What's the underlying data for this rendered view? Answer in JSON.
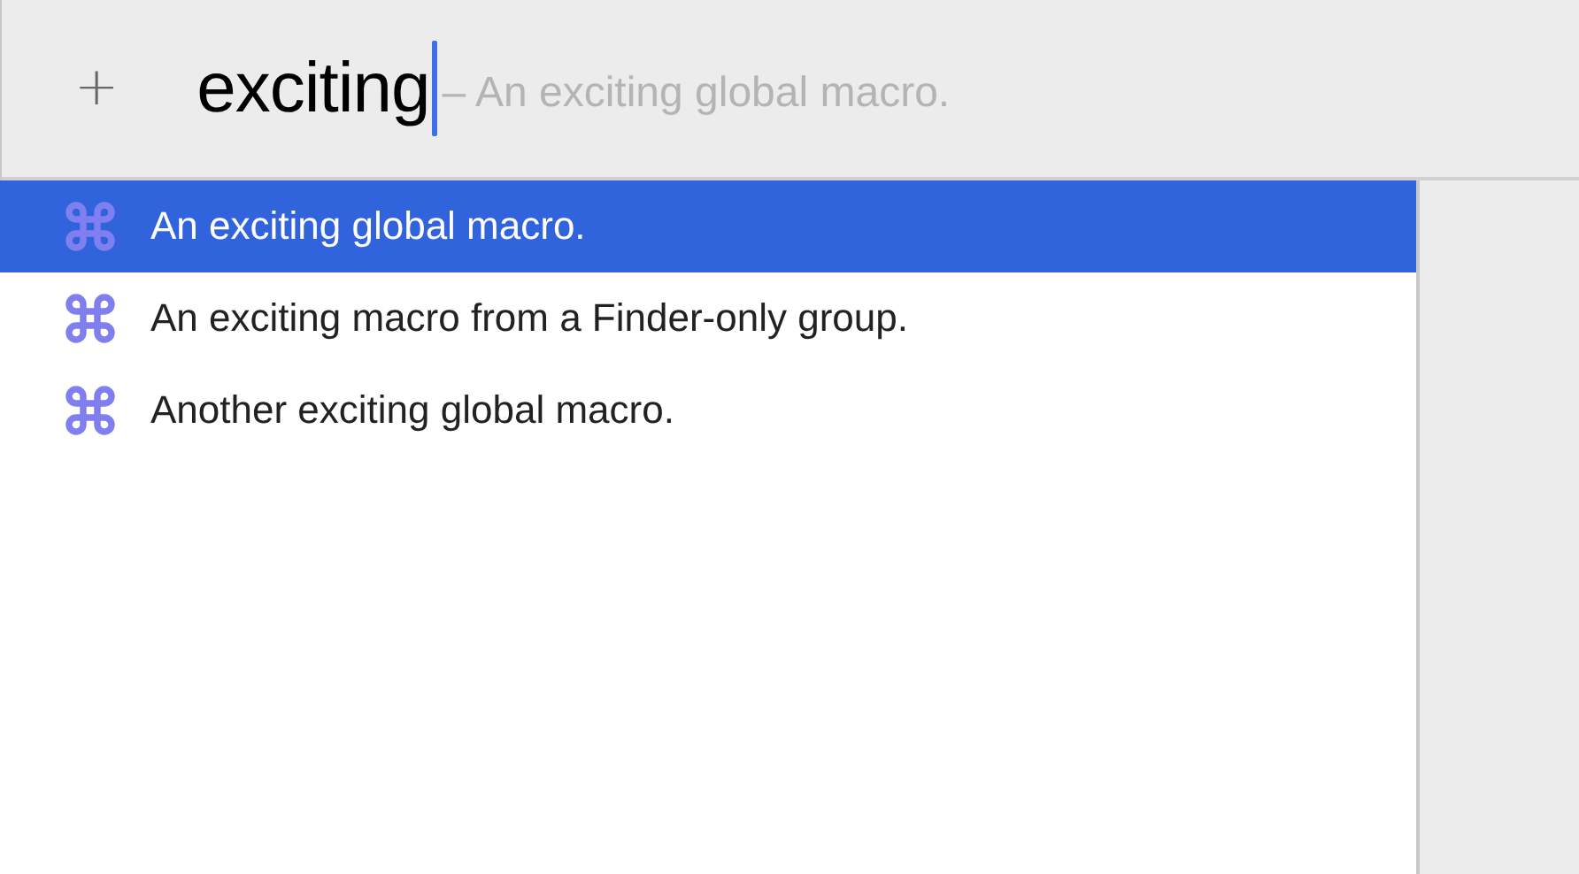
{
  "add_button": {
    "label": "+"
  },
  "search": {
    "value": "exciting",
    "completion_hint": "– An exciting global macro."
  },
  "results": [
    {
      "label": "An exciting global macro.",
      "selected": true
    },
    {
      "label": "An exciting macro from a Finder-only group.",
      "selected": false
    },
    {
      "label": "Another exciting global macro.",
      "selected": false
    }
  ]
}
